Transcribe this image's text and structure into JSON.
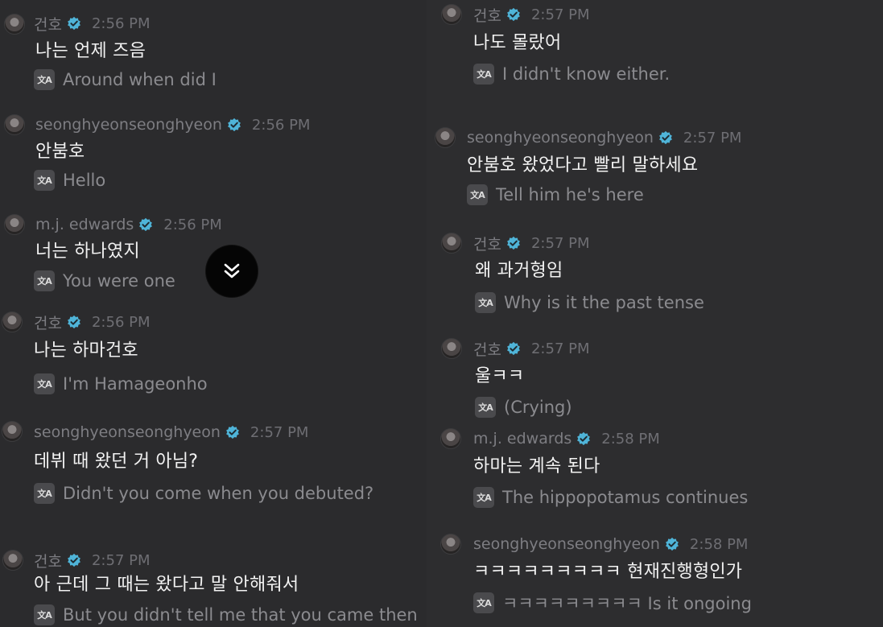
{
  "colors": {
    "background": "#2b2b2d",
    "verified": "#4fb4d8",
    "username": "#7d7d82",
    "message": "#f2f2f2",
    "translation": "#8b8b8f"
  },
  "left": [
    {
      "user": "건호",
      "time": "2:56 PM",
      "text": "나는 언제 즈음",
      "translation": "Around when did I"
    },
    {
      "user": "seonghyeonseonghyeon",
      "time": "2:56 PM",
      "text": "안붐호",
      "translation": "Hello"
    },
    {
      "user": "m.j. edwards",
      "time": "2:56 PM",
      "text": "너는 하나였지",
      "translation": "You were one"
    },
    {
      "user": "건호",
      "time": "2:56 PM",
      "text": "나는 하마건호",
      "translation": "I'm Hamageonho"
    },
    {
      "user": "seonghyeonseonghyeon",
      "time": "2:57 PM",
      "text": "데뷔 때 왔던 거 아님?",
      "translation": "Didn't you come when you debuted?"
    },
    {
      "user": "건호",
      "time": "2:57 PM",
      "text": "아 근데 그 때는 왔다고 말 안해줘서",
      "translation": "But you didn't tell me that you came then"
    }
  ],
  "right": [
    {
      "user": "건호",
      "time": "2:57 PM",
      "text": "나도 몰랐어",
      "translation": "I didn't know either."
    },
    {
      "user": "seonghyeonseonghyeon",
      "time": "2:57 PM",
      "text": "안붐호 왔었다고 빨리 말하세요",
      "translation": "Tell him he's here"
    },
    {
      "user": "건호",
      "time": "2:57 PM",
      "text": "왜 과거형임",
      "translation": "Why is it the past tense"
    },
    {
      "user": "건호",
      "time": "2:57 PM",
      "text": "울ㅋㅋ",
      "translation": "(Crying)"
    },
    {
      "user": "m.j. edwards",
      "time": "2:58 PM",
      "text": "하마는 계속 된다",
      "translation": "The hippopotamus continues"
    },
    {
      "user": "seonghyeonseonghyeon",
      "time": "2:58 PM",
      "text": "ㅋㅋㅋㅋㅋㅋㅋㅋㅋ 현재진행형인가",
      "translation": "ㅋㅋㅋㅋㅋㅋㅋㅋㅋ Is it ongoing"
    }
  ],
  "translate_icon": "translate-icon",
  "scroll_button_icon": "double-chevron-down-icon"
}
